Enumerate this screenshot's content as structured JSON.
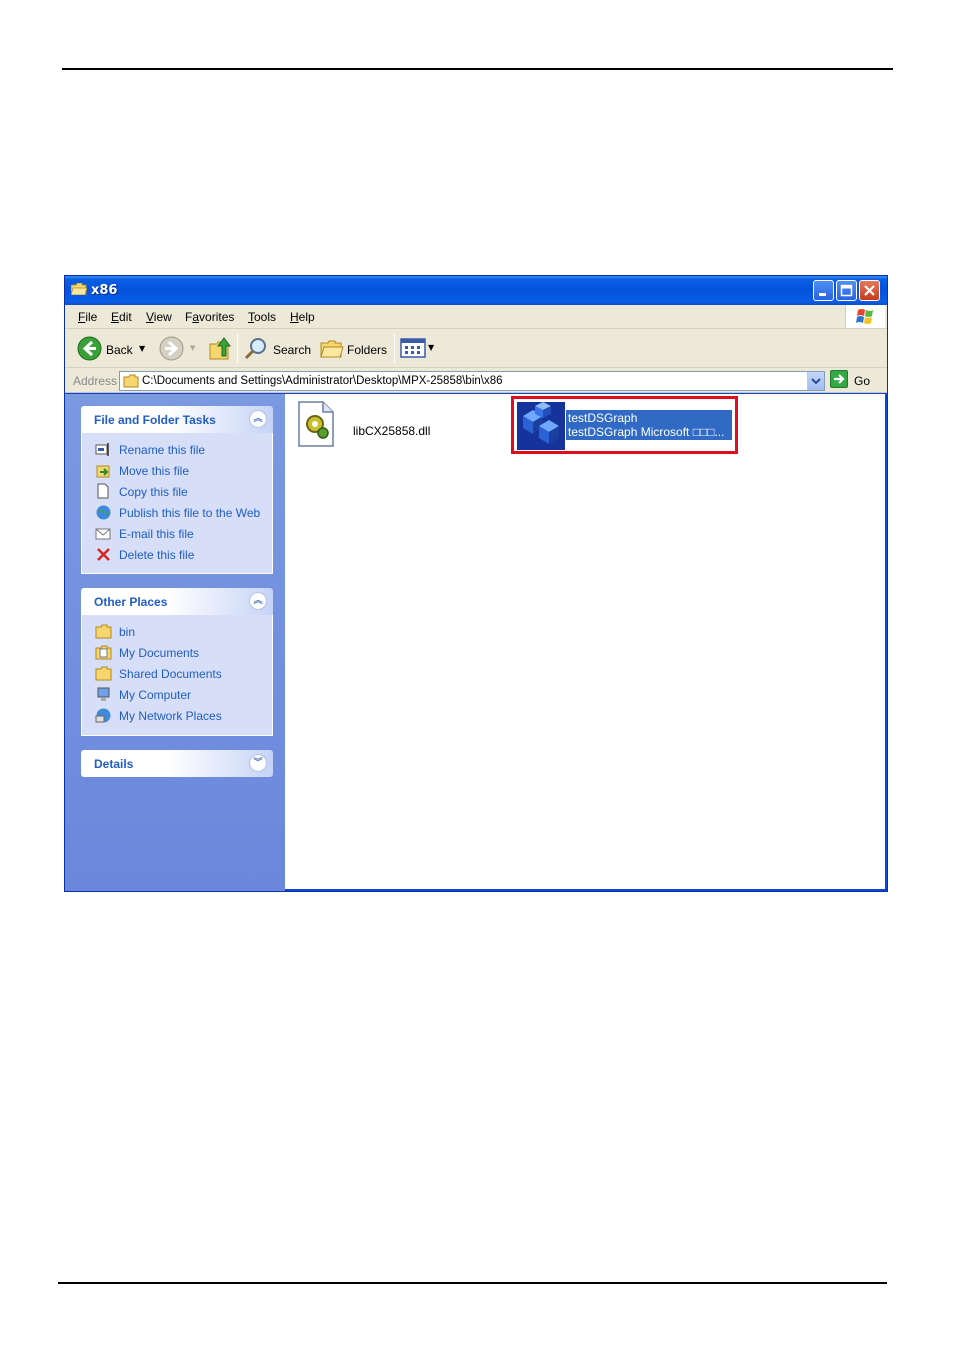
{
  "window": {
    "title": "x86",
    "menu": [
      "File",
      "Edit",
      "View",
      "Favorites",
      "Tools",
      "Help"
    ],
    "menu_access_keys": [
      "F",
      "E",
      "V",
      "a",
      "T",
      "H"
    ]
  },
  "toolbar": {
    "back_label": "Back",
    "search_label": "Search",
    "folders_label": "Folders"
  },
  "address": {
    "label": "Address",
    "value": "C:\\Documents and Settings\\Administrator\\Desktop\\MPX-25858\\bin\\x86",
    "go_label": "Go"
  },
  "sidebar": {
    "file_tasks": {
      "title": "File and Folder Tasks",
      "items": [
        {
          "label": "Rename this file",
          "icon": "rename-icon"
        },
        {
          "label": "Move this file",
          "icon": "move-icon"
        },
        {
          "label": "Copy this file",
          "icon": "copy-icon"
        },
        {
          "label": "Publish this file to the Web",
          "icon": "publish-web-icon"
        },
        {
          "label": "E-mail this file",
          "icon": "email-icon"
        },
        {
          "label": "Delete this file",
          "icon": "delete-icon"
        }
      ]
    },
    "other_places": {
      "title": "Other Places",
      "items": [
        {
          "label": "bin",
          "icon": "folder-icon"
        },
        {
          "label": "My Documents",
          "icon": "my-documents-icon"
        },
        {
          "label": "Shared Documents",
          "icon": "folder-icon"
        },
        {
          "label": "My Computer",
          "icon": "my-computer-icon"
        },
        {
          "label": "My Network Places",
          "icon": "network-places-icon"
        }
      ]
    },
    "details": {
      "title": "Details"
    }
  },
  "files": [
    {
      "name": "libCX25858.dll",
      "icon": "dll-gear-icon",
      "selected": false
    },
    {
      "name": "testDSGraph",
      "description": "testDSGraph Microsoft □□□...",
      "icon": "app-cubes-icon",
      "selected": true
    }
  ],
  "colors": {
    "title_bar": "#0452dd",
    "sidebar_bg": "#7b99e1",
    "link_text": "#215dc6",
    "selection": "#316ac5",
    "highlight_box": "#e00d1e"
  }
}
